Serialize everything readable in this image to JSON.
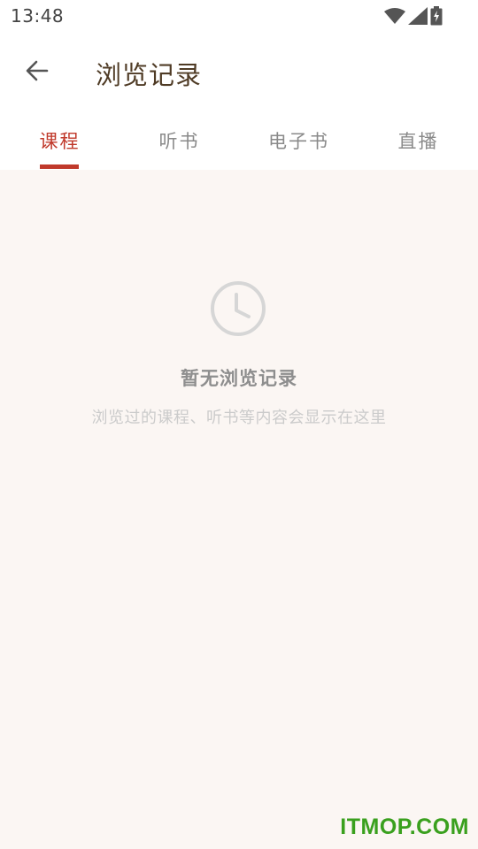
{
  "status_bar": {
    "time": "13:48",
    "icons": [
      "wifi-icon",
      "signal-icon",
      "battery-charging-icon"
    ]
  },
  "header": {
    "back_icon": "arrow-left-icon",
    "title": "浏览记录"
  },
  "tabs": [
    {
      "label": "课程",
      "active": true
    },
    {
      "label": "听书",
      "active": false
    },
    {
      "label": "电子书",
      "active": false
    },
    {
      "label": "直播",
      "active": false
    }
  ],
  "empty_state": {
    "icon": "clock-icon",
    "title": "暂无浏览记录",
    "subtitle": "浏览过的课程、听书等内容会显示在这里"
  },
  "watermark": "ITMOP.COM",
  "colors": {
    "accent": "#c0392b",
    "title": "#4f3b25",
    "content_background": "#fbf6f3",
    "watermark": "#3aa01e"
  }
}
